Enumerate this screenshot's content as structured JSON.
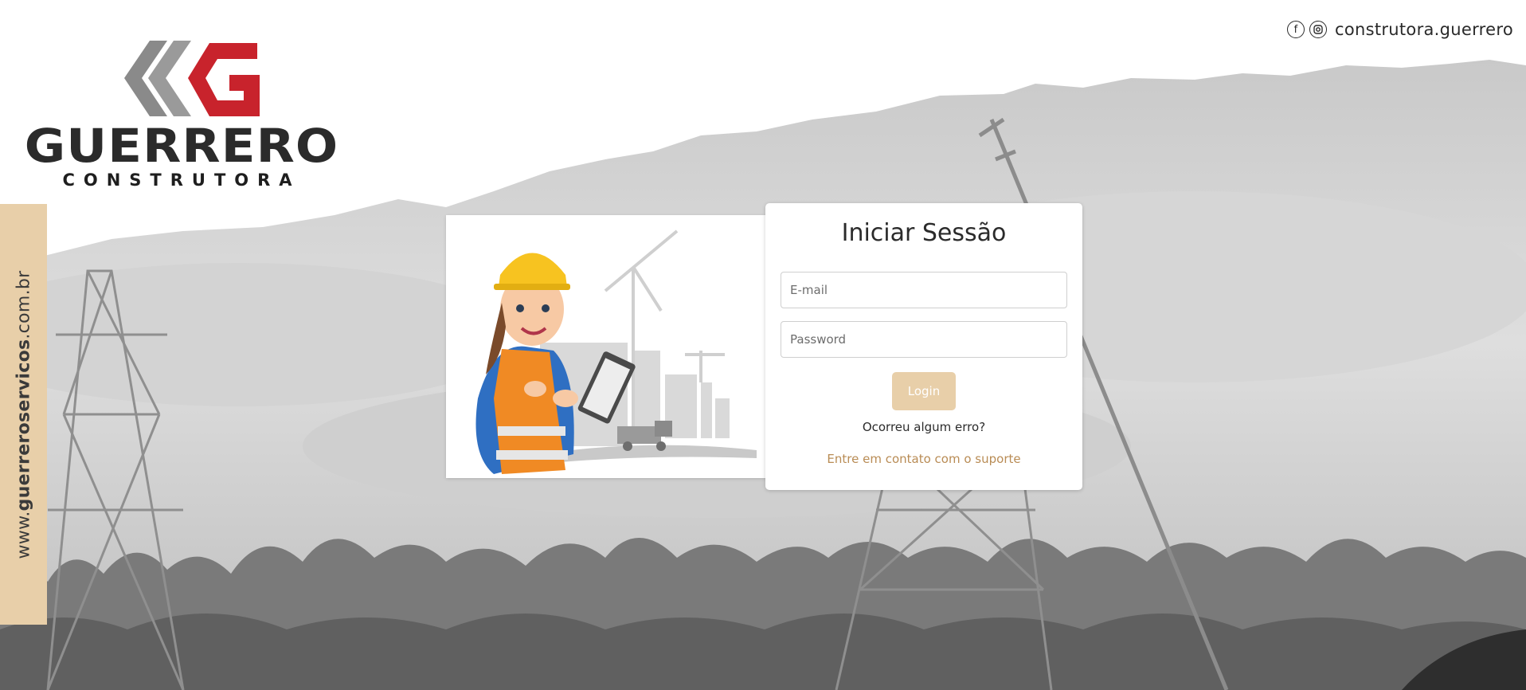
{
  "brand": {
    "name": "GUERRERO",
    "sub": "CONSTRUTORA",
    "colors": {
      "red": "#c8232c",
      "gray": "#8a8a8a",
      "dark": "#2b2b2b",
      "accent": "#e8cfa9",
      "link": "#b98c55"
    }
  },
  "social": {
    "icons": [
      "facebook-icon",
      "instagram-icon"
    ],
    "handle": "construtora.guerrero"
  },
  "side": {
    "prefix": "www.",
    "bold": "guerreroservicos",
    "suffix": ".com.br"
  },
  "login": {
    "title": "Iniciar Sessão",
    "email_placeholder": "E-mail",
    "password_placeholder": "Password",
    "button_label": "Login",
    "error_text": "Ocorreu algum erro?",
    "support_link": "Entre em contato com o suporte"
  }
}
